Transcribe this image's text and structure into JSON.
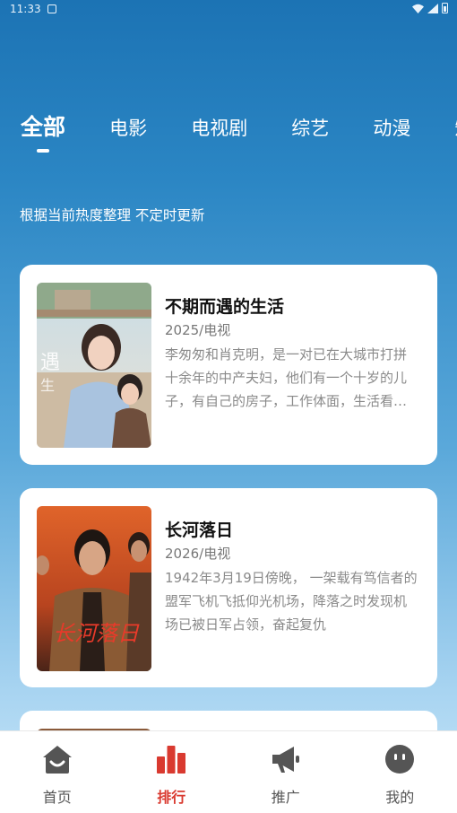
{
  "status_bar": {
    "time": "11:33"
  },
  "tabs": [
    {
      "label": "全部",
      "active": true
    },
    {
      "label": "电影"
    },
    {
      "label": "电视剧"
    },
    {
      "label": "综艺"
    },
    {
      "label": "动漫"
    },
    {
      "label": "短"
    }
  ],
  "subtitle": "根据当前热度整理 不定时更新",
  "items": [
    {
      "title": "不期而遇的生活",
      "meta": "2025/电视",
      "description": "李匆匆和肖克明，是一对已在大城市打拼十余年的中产夫妇，他们有一个十岁的儿子，有自己的房子，工作体面，生活看似安稳"
    },
    {
      "title": "长河落日",
      "meta": "2026/电视",
      "description": "1942年3月19日傍晚， 一架载有笃信者的盟军飞机飞抵仰光机场，降落之时发现机场已被日军占领，奋起复仇"
    }
  ],
  "nav": [
    {
      "label": "首页",
      "icon": "home-icon"
    },
    {
      "label": "排行",
      "icon": "ranking-icon",
      "active": true
    },
    {
      "label": "推广",
      "icon": "megaphone-icon"
    },
    {
      "label": "我的",
      "icon": "profile-icon"
    }
  ],
  "colors": {
    "accent": "#d93a30",
    "nav_inactive": "#555555"
  }
}
